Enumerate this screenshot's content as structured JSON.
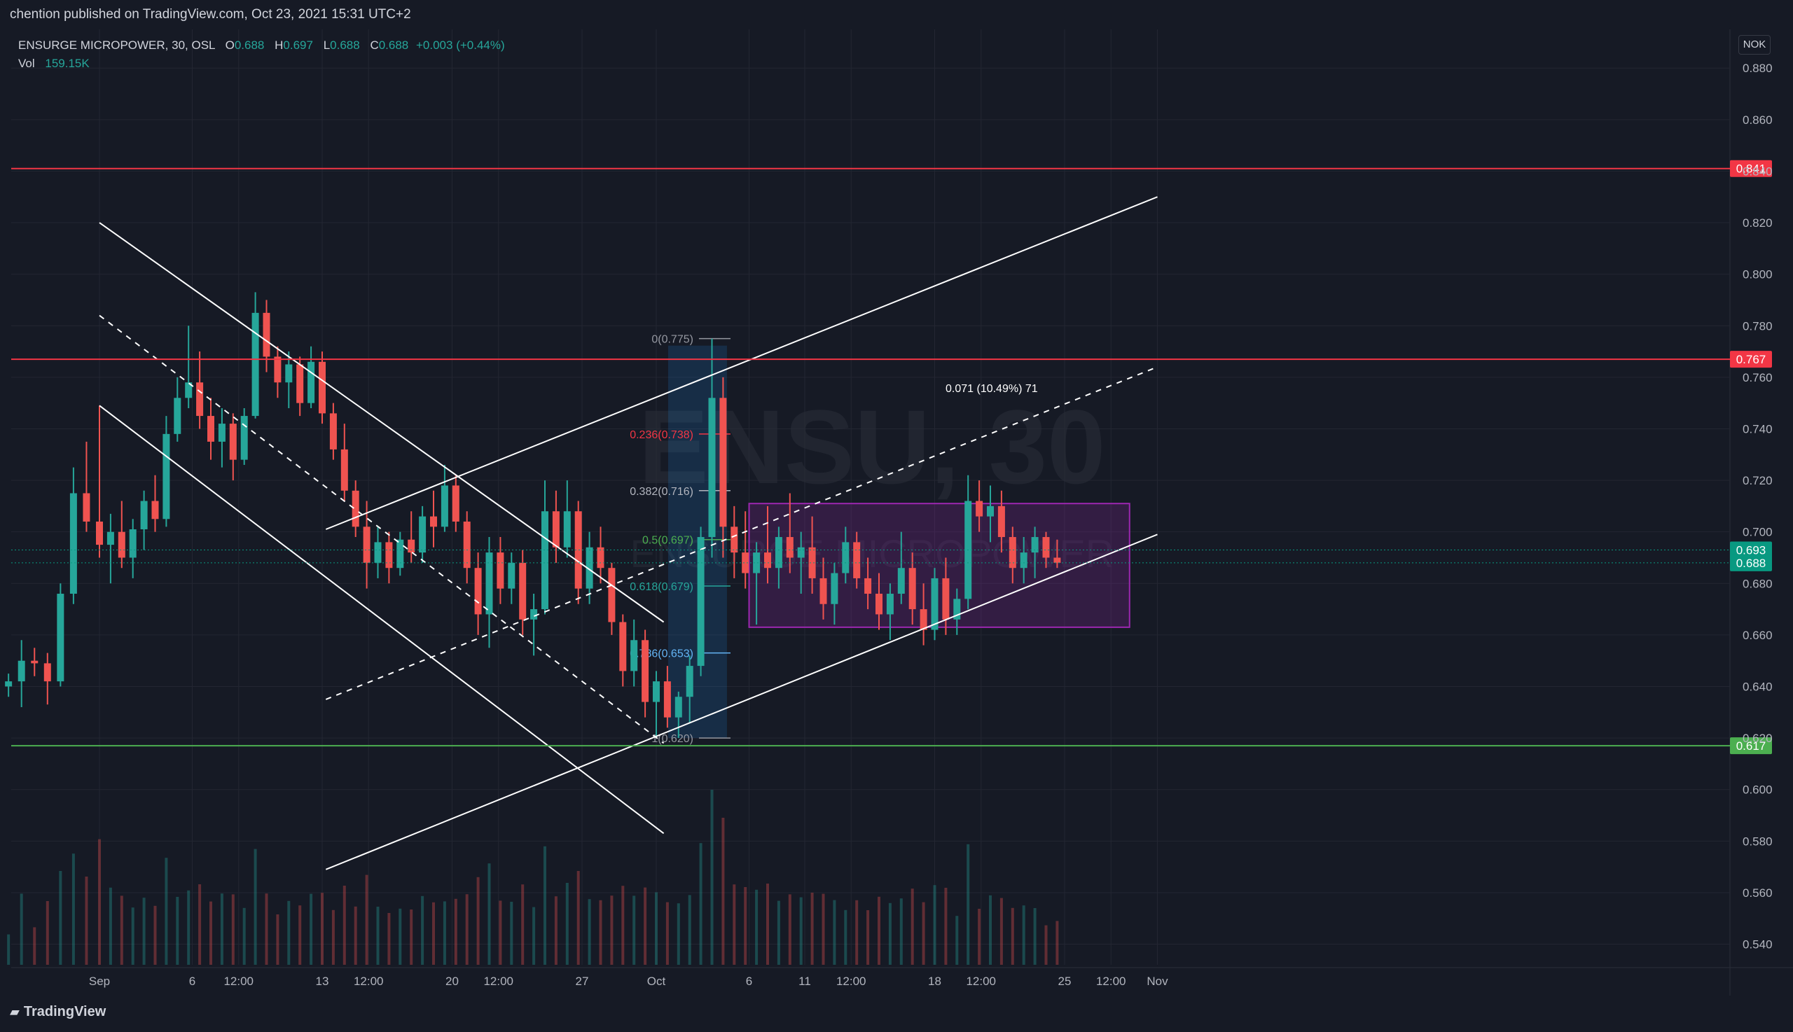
{
  "header": {
    "published": "chention published on TradingView.com, Oct 23, 2021 15:31 UTC+2"
  },
  "legend": {
    "symbol": "ENSURGE MICROPOWER, 30, OSL",
    "o_label": "O",
    "o": "0.688",
    "h_label": "H",
    "h": "0.697",
    "l_label": "L",
    "l": "0.688",
    "c_label": "C",
    "c": "0.688",
    "change": "+0.003 (+0.44%)",
    "vol_label": "Vol",
    "vol": "159.15K"
  },
  "currency": "NOK",
  "watermark": {
    "symbol": "ENSU, 30",
    "name": "ENSURGE MICROPOWER"
  },
  "footer": {
    "brand": "TradingView"
  },
  "chart_data": {
    "type": "candlestick",
    "ylim": [
      0.532,
      0.895
    ],
    "y_ticks": [
      "0.880",
      "0.860",
      "0.840",
      "0.820",
      "0.800",
      "0.780",
      "0.760",
      "0.740",
      "0.720",
      "0.700",
      "0.680",
      "0.660",
      "0.640",
      "0.620",
      "0.600",
      "0.580",
      "0.560",
      "0.540"
    ],
    "x_ticks": [
      "Sep",
      "6",
      "12:00",
      "13",
      "12:00",
      "20",
      "12:00",
      "27",
      "Oct",
      "6",
      "11",
      "12:00",
      "18",
      "12:00",
      "25",
      "12:00",
      "Nov"
    ],
    "x_tick_days": [
      0,
      5,
      7.5,
      12,
      14.5,
      19,
      21.5,
      26,
      30,
      35,
      38,
      40.5,
      45,
      47.5,
      52,
      54.5,
      57
    ],
    "x_start_day": -4.9,
    "x_end_day": 57.7,
    "x_labels_start": "Aug 27",
    "horizontal_levels": [
      {
        "value": 0.841,
        "label": "0.841",
        "color": "#f23645"
      },
      {
        "value": 0.767,
        "label": "0.767",
        "color": "#f23645"
      },
      {
        "value": 0.617,
        "label": "0.617",
        "color": "#4caf50"
      }
    ],
    "price_tags": [
      {
        "value": 0.693,
        "label": "0.693",
        "color": "#089981"
      },
      {
        "value": 0.688,
        "label": "0.688",
        "color": "#089981"
      }
    ],
    "fibonacci": {
      "levels": [
        {
          "ratio": "0",
          "price": 0.775,
          "label": "0(0.775)",
          "color": "#9598a1"
        },
        {
          "ratio": "0.236",
          "price": 0.738,
          "label": "0.236(0.738)",
          "color": "#f23645"
        },
        {
          "ratio": "0.382",
          "price": 0.716,
          "label": "0.382(0.716)",
          "color": "#b2b5be"
        },
        {
          "ratio": "0.5",
          "price": 0.697,
          "label": "0.5(0.697)",
          "color": "#4caf50"
        },
        {
          "ratio": "0.618",
          "price": 0.679,
          "label": "0.618(0.679)",
          "color": "#26a69a"
        },
        {
          "ratio": "0.786",
          "price": 0.653,
          "label": "0.786(0.653)",
          "color": "#64b5f6"
        },
        {
          "ratio": "1",
          "price": 0.62,
          "label": "1(0.620)",
          "color": "#9598a1"
        }
      ]
    },
    "measure_label": "0.071 (10.49%) 71",
    "range_box": {
      "top": 0.711,
      "bottom": 0.663,
      "start_day": 35,
      "end_day": 55.5
    },
    "trendlines": [
      {
        "style": "solid",
        "p1": [
          0,
          0.82
        ],
        "p2": [
          30.4,
          0.665
        ]
      },
      {
        "style": "solid",
        "p1": [
          0,
          0.749
        ],
        "p2": [
          30.4,
          0.583
        ]
      },
      {
        "style": "dashed",
        "p1": [
          0,
          0.784
        ],
        "p2": [
          30.4,
          0.618
        ]
      },
      {
        "style": "solid",
        "p1": [
          12.2,
          0.569
        ],
        "p2": [
          57,
          0.699
        ]
      },
      {
        "style": "dashed",
        "p1": [
          12.2,
          0.635
        ],
        "p2": [
          57,
          0.764
        ]
      },
      {
        "style": "solid",
        "p1": [
          12.2,
          0.701
        ],
        "p2": [
          57,
          0.83
        ]
      }
    ],
    "candles": [
      {
        "d": -4.9,
        "o": 0.64,
        "h": 0.645,
        "l": 0.636,
        "c": 0.642
      },
      {
        "d": -4.2,
        "o": 0.642,
        "h": 0.658,
        "l": 0.632,
        "c": 0.65
      },
      {
        "d": -3.5,
        "o": 0.65,
        "h": 0.655,
        "l": 0.644,
        "c": 0.649
      },
      {
        "d": -2.8,
        "o": 0.649,
        "h": 0.653,
        "l": 0.633,
        "c": 0.642
      },
      {
        "d": -2.1,
        "o": 0.642,
        "h": 0.68,
        "l": 0.64,
        "c": 0.676
      },
      {
        "d": -1.4,
        "o": 0.676,
        "h": 0.725,
        "l": 0.672,
        "c": 0.715
      },
      {
        "d": -0.7,
        "o": 0.715,
        "h": 0.735,
        "l": 0.7,
        "c": 0.704
      },
      {
        "d": 0.0,
        "o": 0.704,
        "h": 0.749,
        "l": 0.69,
        "c": 0.695
      },
      {
        "d": 0.6,
        "o": 0.695,
        "h": 0.707,
        "l": 0.68,
        "c": 0.7
      },
      {
        "d": 1.2,
        "o": 0.7,
        "h": 0.712,
        "l": 0.686,
        "c": 0.69
      },
      {
        "d": 1.8,
        "o": 0.69,
        "h": 0.705,
        "l": 0.682,
        "c": 0.701
      },
      {
        "d": 2.4,
        "o": 0.701,
        "h": 0.716,
        "l": 0.693,
        "c": 0.712
      },
      {
        "d": 3.0,
        "o": 0.712,
        "h": 0.722,
        "l": 0.7,
        "c": 0.705
      },
      {
        "d": 3.6,
        "o": 0.705,
        "h": 0.745,
        "l": 0.702,
        "c": 0.738
      },
      {
        "d": 4.2,
        "o": 0.738,
        "h": 0.76,
        "l": 0.735,
        "c": 0.752
      },
      {
        "d": 4.8,
        "o": 0.752,
        "h": 0.78,
        "l": 0.748,
        "c": 0.758
      },
      {
        "d": 5.4,
        "o": 0.758,
        "h": 0.77,
        "l": 0.74,
        "c": 0.745
      },
      {
        "d": 6.0,
        "o": 0.745,
        "h": 0.752,
        "l": 0.728,
        "c": 0.735
      },
      {
        "d": 6.6,
        "o": 0.735,
        "h": 0.748,
        "l": 0.725,
        "c": 0.742
      },
      {
        "d": 7.2,
        "o": 0.742,
        "h": 0.746,
        "l": 0.72,
        "c": 0.728
      },
      {
        "d": 7.8,
        "o": 0.728,
        "h": 0.748,
        "l": 0.726,
        "c": 0.745
      },
      {
        "d": 8.4,
        "o": 0.745,
        "h": 0.793,
        "l": 0.744,
        "c": 0.785
      },
      {
        "d": 9.0,
        "o": 0.785,
        "h": 0.79,
        "l": 0.762,
        "c": 0.768
      },
      {
        "d": 9.6,
        "o": 0.768,
        "h": 0.772,
        "l": 0.752,
        "c": 0.758
      },
      {
        "d": 10.2,
        "o": 0.758,
        "h": 0.77,
        "l": 0.748,
        "c": 0.765
      },
      {
        "d": 10.8,
        "o": 0.765,
        "h": 0.768,
        "l": 0.745,
        "c": 0.75
      },
      {
        "d": 11.4,
        "o": 0.75,
        "h": 0.772,
        "l": 0.748,
        "c": 0.766
      },
      {
        "d": 12.0,
        "o": 0.766,
        "h": 0.77,
        "l": 0.742,
        "c": 0.746
      },
      {
        "d": 12.6,
        "o": 0.746,
        "h": 0.75,
        "l": 0.728,
        "c": 0.732
      },
      {
        "d": 13.2,
        "o": 0.732,
        "h": 0.742,
        "l": 0.712,
        "c": 0.716
      },
      {
        "d": 13.8,
        "o": 0.716,
        "h": 0.72,
        "l": 0.698,
        "c": 0.702
      },
      {
        "d": 14.4,
        "o": 0.702,
        "h": 0.712,
        "l": 0.678,
        "c": 0.688
      },
      {
        "d": 15.0,
        "o": 0.688,
        "h": 0.702,
        "l": 0.682,
        "c": 0.696
      },
      {
        "d": 15.6,
        "o": 0.696,
        "h": 0.7,
        "l": 0.68,
        "c": 0.686
      },
      {
        "d": 16.2,
        "o": 0.686,
        "h": 0.7,
        "l": 0.683,
        "c": 0.697
      },
      {
        "d": 16.8,
        "o": 0.697,
        "h": 0.708,
        "l": 0.688,
        "c": 0.692
      },
      {
        "d": 17.4,
        "o": 0.692,
        "h": 0.71,
        "l": 0.688,
        "c": 0.706
      },
      {
        "d": 18.0,
        "o": 0.706,
        "h": 0.716,
        "l": 0.694,
        "c": 0.702
      },
      {
        "d": 18.6,
        "o": 0.702,
        "h": 0.726,
        "l": 0.7,
        "c": 0.718
      },
      {
        "d": 19.2,
        "o": 0.718,
        "h": 0.722,
        "l": 0.7,
        "c": 0.704
      },
      {
        "d": 19.8,
        "o": 0.704,
        "h": 0.708,
        "l": 0.68,
        "c": 0.686
      },
      {
        "d": 20.4,
        "o": 0.686,
        "h": 0.692,
        "l": 0.66,
        "c": 0.668
      },
      {
        "d": 21.0,
        "o": 0.668,
        "h": 0.698,
        "l": 0.655,
        "c": 0.692
      },
      {
        "d": 21.6,
        "o": 0.692,
        "h": 0.698,
        "l": 0.672,
        "c": 0.678
      },
      {
        "d": 22.2,
        "o": 0.678,
        "h": 0.692,
        "l": 0.672,
        "c": 0.688
      },
      {
        "d": 22.8,
        "o": 0.688,
        "h": 0.693,
        "l": 0.66,
        "c": 0.666
      },
      {
        "d": 23.4,
        "o": 0.666,
        "h": 0.676,
        "l": 0.652,
        "c": 0.67
      },
      {
        "d": 24.0,
        "o": 0.67,
        "h": 0.72,
        "l": 0.668,
        "c": 0.708
      },
      {
        "d": 24.6,
        "o": 0.708,
        "h": 0.716,
        "l": 0.688,
        "c": 0.694
      },
      {
        "d": 25.2,
        "o": 0.694,
        "h": 0.72,
        "l": 0.69,
        "c": 0.708
      },
      {
        "d": 25.8,
        "o": 0.708,
        "h": 0.712,
        "l": 0.672,
        "c": 0.678
      },
      {
        "d": 26.4,
        "o": 0.678,
        "h": 0.7,
        "l": 0.672,
        "c": 0.694
      },
      {
        "d": 27.0,
        "o": 0.694,
        "h": 0.702,
        "l": 0.68,
        "c": 0.686
      },
      {
        "d": 27.6,
        "o": 0.686,
        "h": 0.688,
        "l": 0.66,
        "c": 0.665
      },
      {
        "d": 28.2,
        "o": 0.665,
        "h": 0.668,
        "l": 0.64,
        "c": 0.646
      },
      {
        "d": 28.8,
        "o": 0.646,
        "h": 0.666,
        "l": 0.64,
        "c": 0.658
      },
      {
        "d": 29.4,
        "o": 0.658,
        "h": 0.662,
        "l": 0.628,
        "c": 0.634
      },
      {
        "d": 30.0,
        "o": 0.634,
        "h": 0.646,
        "l": 0.62,
        "c": 0.642
      },
      {
        "d": 30.6,
        "o": 0.642,
        "h": 0.648,
        "l": 0.624,
        "c": 0.628
      },
      {
        "d": 31.2,
        "o": 0.628,
        "h": 0.638,
        "l": 0.62,
        "c": 0.636
      },
      {
        "d": 31.8,
        "o": 0.636,
        "h": 0.652,
        "l": 0.626,
        "c": 0.648
      },
      {
        "d": 32.4,
        "o": 0.648,
        "h": 0.702,
        "l": 0.644,
        "c": 0.698
      },
      {
        "d": 33.0,
        "o": 0.698,
        "h": 0.775,
        "l": 0.69,
        "c": 0.752
      },
      {
        "d": 33.6,
        "o": 0.752,
        "h": 0.76,
        "l": 0.69,
        "c": 0.702
      },
      {
        "d": 34.2,
        "o": 0.702,
        "h": 0.71,
        "l": 0.682,
        "c": 0.692
      },
      {
        "d": 34.8,
        "o": 0.692,
        "h": 0.708,
        "l": 0.678,
        "c": 0.684
      },
      {
        "d": 35.4,
        "o": 0.684,
        "h": 0.696,
        "l": 0.664,
        "c": 0.692
      },
      {
        "d": 36.0,
        "o": 0.692,
        "h": 0.71,
        "l": 0.68,
        "c": 0.686
      },
      {
        "d": 36.6,
        "o": 0.686,
        "h": 0.702,
        "l": 0.678,
        "c": 0.698
      },
      {
        "d": 37.2,
        "o": 0.698,
        "h": 0.715,
        "l": 0.684,
        "c": 0.69
      },
      {
        "d": 37.8,
        "o": 0.69,
        "h": 0.7,
        "l": 0.676,
        "c": 0.694
      },
      {
        "d": 38.4,
        "o": 0.694,
        "h": 0.706,
        "l": 0.676,
        "c": 0.682
      },
      {
        "d": 39.0,
        "o": 0.682,
        "h": 0.69,
        "l": 0.666,
        "c": 0.672
      },
      {
        "d": 39.6,
        "o": 0.672,
        "h": 0.688,
        "l": 0.664,
        "c": 0.684
      },
      {
        "d": 40.2,
        "o": 0.684,
        "h": 0.702,
        "l": 0.68,
        "c": 0.696
      },
      {
        "d": 40.8,
        "o": 0.696,
        "h": 0.7,
        "l": 0.678,
        "c": 0.682
      },
      {
        "d": 41.4,
        "o": 0.682,
        "h": 0.69,
        "l": 0.67,
        "c": 0.676
      },
      {
        "d": 42.0,
        "o": 0.676,
        "h": 0.684,
        "l": 0.662,
        "c": 0.668
      },
      {
        "d": 42.6,
        "o": 0.668,
        "h": 0.68,
        "l": 0.658,
        "c": 0.676
      },
      {
        "d": 43.2,
        "o": 0.676,
        "h": 0.7,
        "l": 0.672,
        "c": 0.686
      },
      {
        "d": 43.8,
        "o": 0.686,
        "h": 0.692,
        "l": 0.664,
        "c": 0.67
      },
      {
        "d": 44.4,
        "o": 0.67,
        "h": 0.68,
        "l": 0.656,
        "c": 0.662
      },
      {
        "d": 45.0,
        "o": 0.662,
        "h": 0.686,
        "l": 0.658,
        "c": 0.682
      },
      {
        "d": 45.6,
        "o": 0.682,
        "h": 0.69,
        "l": 0.66,
        "c": 0.666
      },
      {
        "d": 46.2,
        "o": 0.666,
        "h": 0.678,
        "l": 0.66,
        "c": 0.674
      },
      {
        "d": 46.8,
        "o": 0.674,
        "h": 0.722,
        "l": 0.67,
        "c": 0.712
      },
      {
        "d": 47.4,
        "o": 0.712,
        "h": 0.72,
        "l": 0.7,
        "c": 0.706
      },
      {
        "d": 48.0,
        "o": 0.706,
        "h": 0.718,
        "l": 0.696,
        "c": 0.71
      },
      {
        "d": 48.6,
        "o": 0.71,
        "h": 0.716,
        "l": 0.692,
        "c": 0.698
      },
      {
        "d": 49.2,
        "o": 0.698,
        "h": 0.702,
        "l": 0.68,
        "c": 0.686
      },
      {
        "d": 49.8,
        "o": 0.686,
        "h": 0.698,
        "l": 0.68,
        "c": 0.692
      },
      {
        "d": 50.4,
        "o": 0.692,
        "h": 0.702,
        "l": 0.682,
        "c": 0.698
      },
      {
        "d": 51.0,
        "o": 0.698,
        "h": 0.7,
        "l": 0.686,
        "c": 0.69
      },
      {
        "d": 51.6,
        "o": 0.69,
        "h": 0.697,
        "l": 0.686,
        "c": 0.688
      }
    ]
  }
}
